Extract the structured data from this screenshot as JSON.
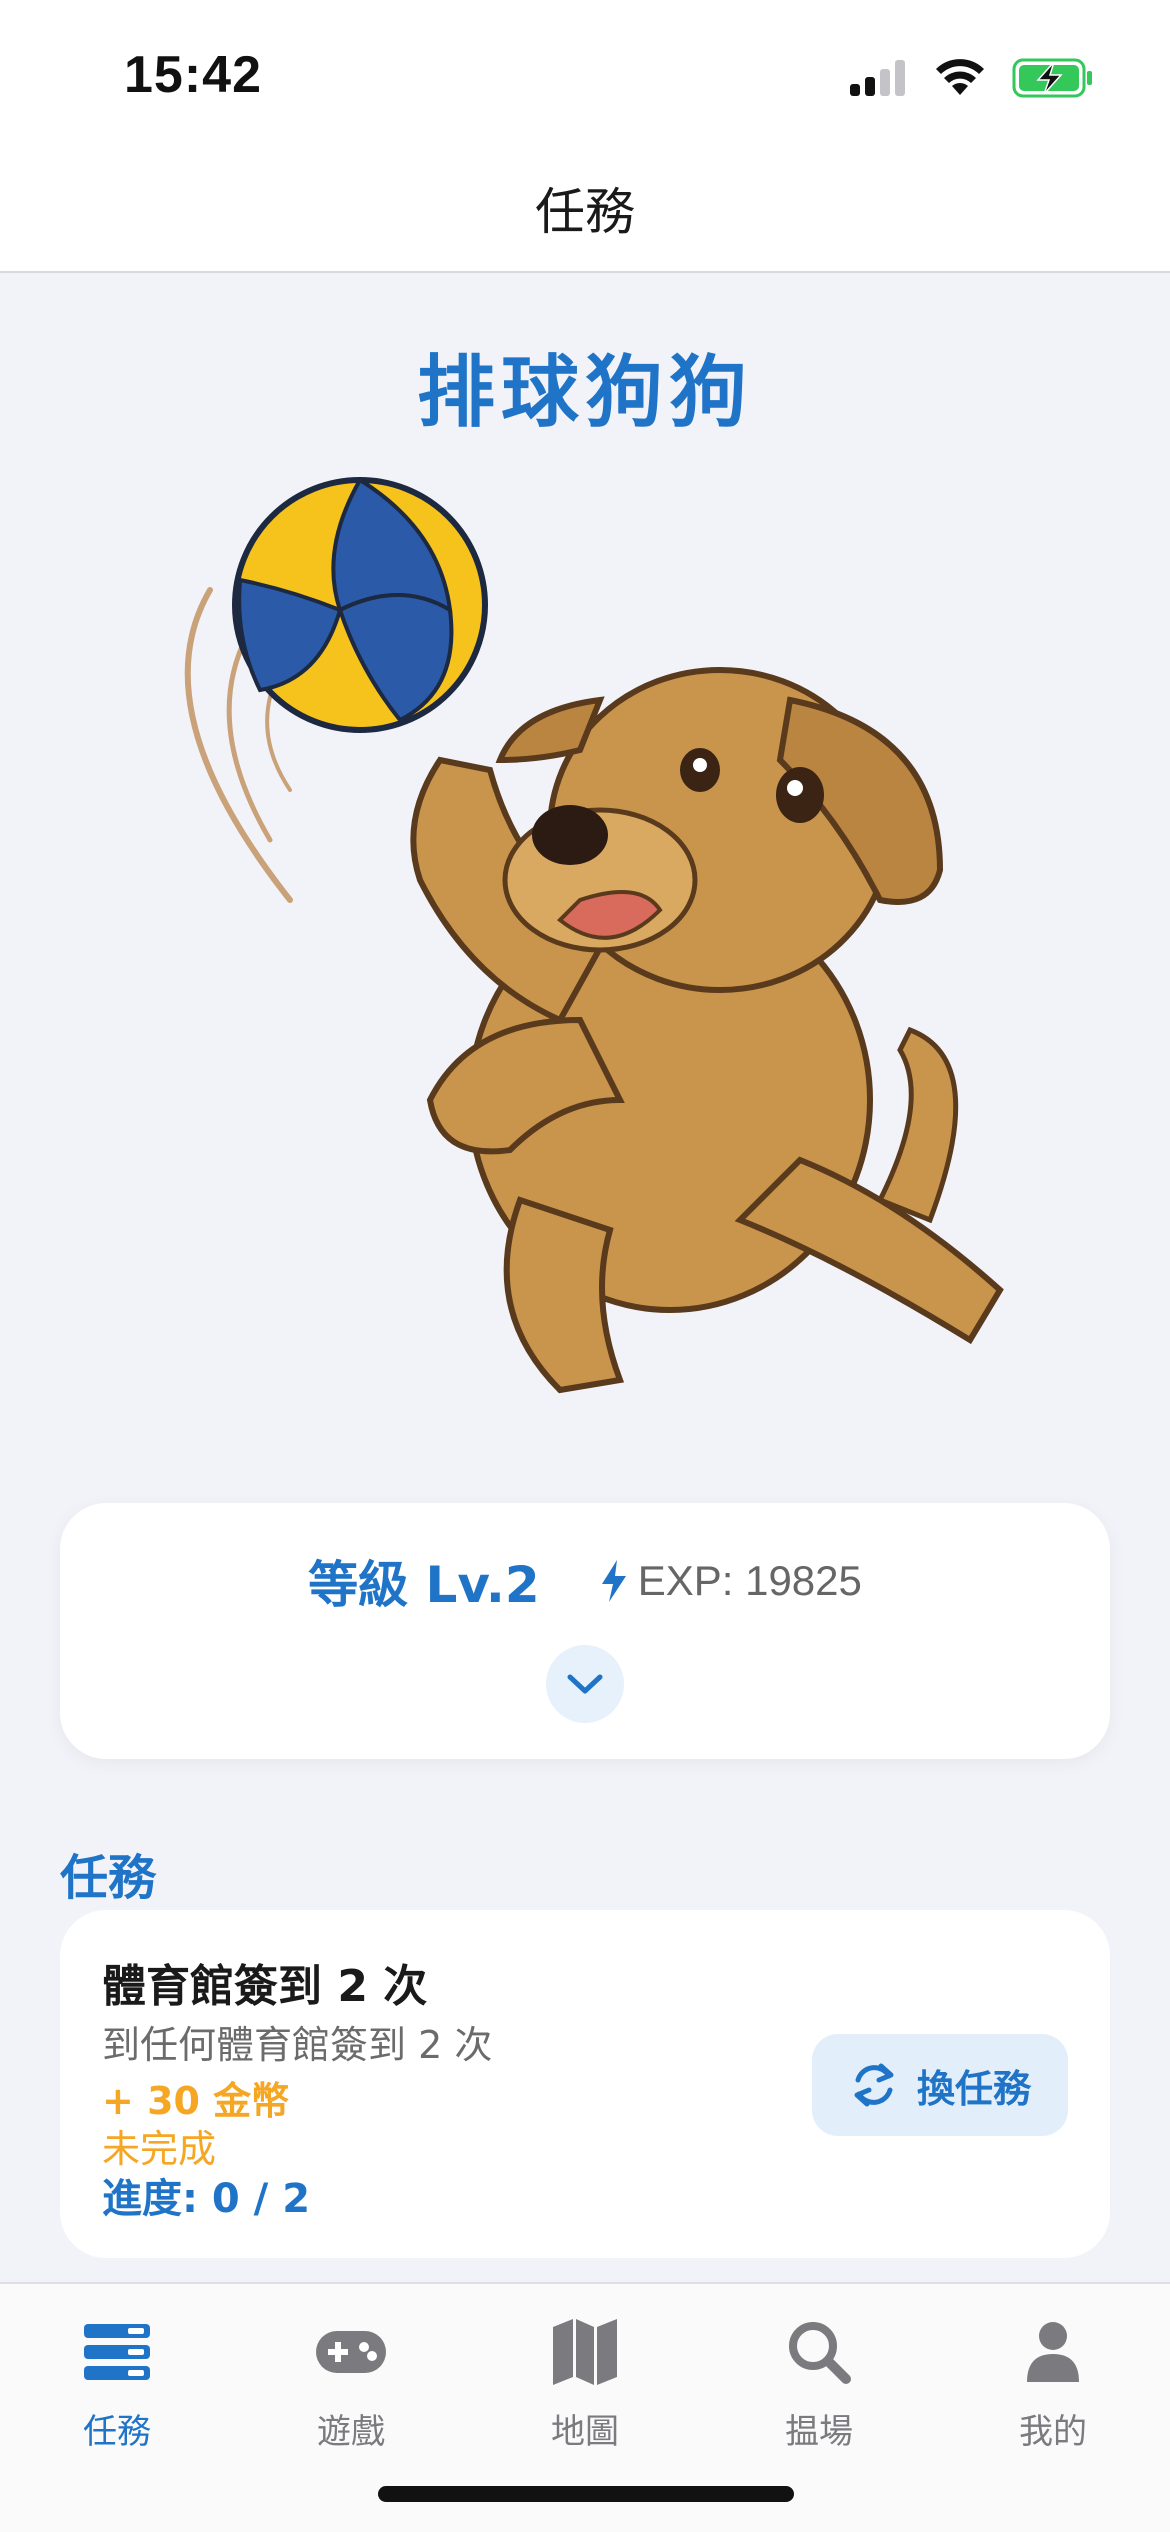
{
  "status_bar": {
    "time": "15:42"
  },
  "header": {
    "title": "任務"
  },
  "character": {
    "name": "排球狗狗"
  },
  "level": {
    "label": "等級 Lv.2",
    "exp": "EXP: 19825"
  },
  "missions": {
    "section_title": "任務",
    "item": {
      "title": "體育館簽到 2 次",
      "description": "到任何體育館簽到 2 次",
      "reward": "+ 30 金幣",
      "status": "未完成",
      "progress": "進度: 0 / 2",
      "swap_label": "換任務"
    }
  },
  "tabbar": {
    "items": [
      {
        "label": "任務",
        "icon": "tasks-icon",
        "active": true
      },
      {
        "label": "遊戲",
        "icon": "gamepad-icon",
        "active": false
      },
      {
        "label": "地圖",
        "icon": "map-icon",
        "active": false
      },
      {
        "label": "揾場",
        "icon": "search-icon",
        "active": false
      },
      {
        "label": "我的",
        "icon": "user-icon",
        "active": false
      }
    ]
  },
  "colors": {
    "accent": "#1f74c7",
    "reward": "#f5a623",
    "ball_yellow": "#f6c21c",
    "ball_blue": "#2a5aa8",
    "dog": "#c9954c"
  }
}
